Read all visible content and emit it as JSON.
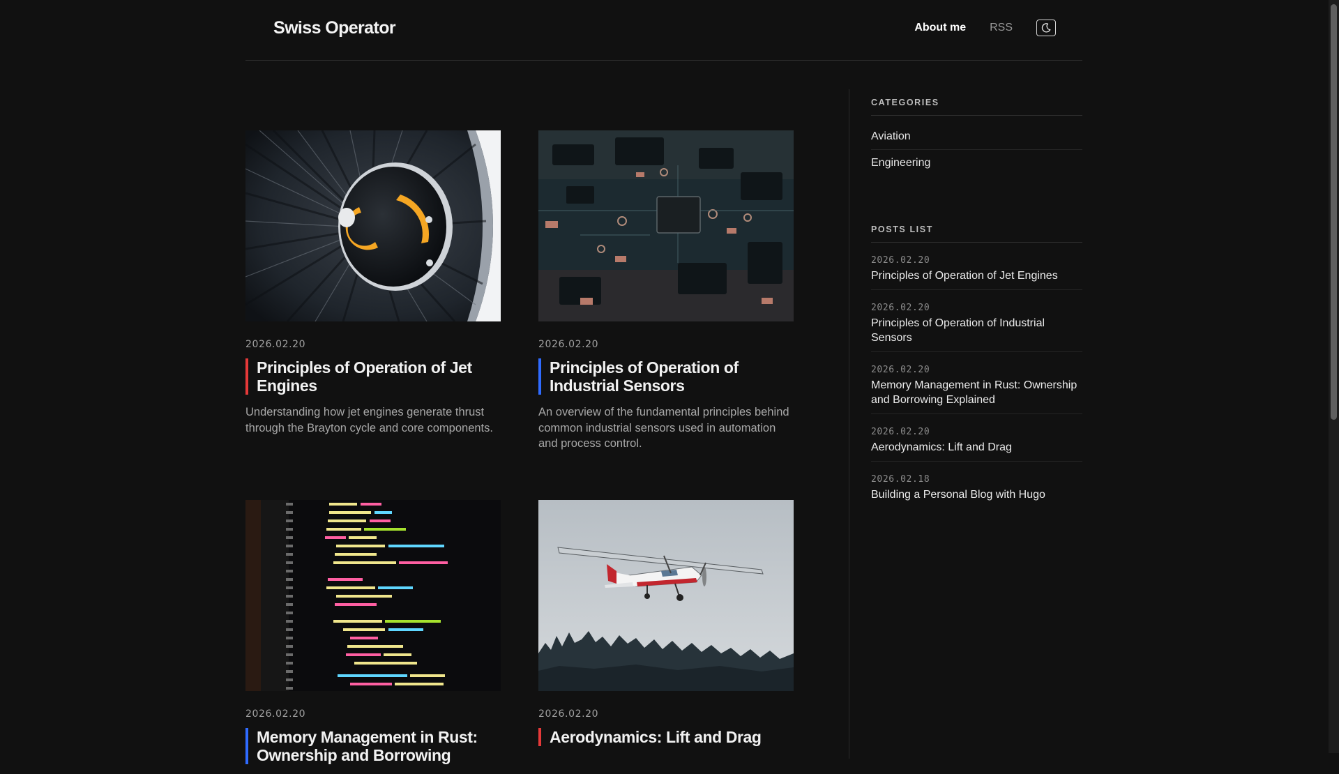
{
  "header": {
    "brand": "Swiss Operator",
    "nav": {
      "about": "About me",
      "rss": "RSS"
    },
    "theme_toggle_icon": "moon-icon"
  },
  "posts": [
    {
      "date": "2026.02.20",
      "title": "Principles of Operation of Jet Engines",
      "excerpt": "Understanding how jet engines generate thrust through the Brayton cycle and core components.",
      "accent": "#e53939",
      "image": "jet-engine-fan-image"
    },
    {
      "date": "2026.02.20",
      "title": "Principles of Operation of Industrial Sensors",
      "excerpt": "An overview of the fundamental principles behind common industrial sensors used in automation and process control.",
      "accent": "#2f6bff",
      "image": "circuit-board-image"
    },
    {
      "date": "2026.02.20",
      "title": "Memory Management in Rust: Ownership and Borrowing",
      "excerpt": "",
      "accent": "#2f6bff",
      "image": "code-screen-image"
    },
    {
      "date": "2026.02.20",
      "title": "Aerodynamics: Lift and Drag",
      "excerpt": "",
      "accent": "#e53939",
      "image": "airplane-image"
    }
  ],
  "sidebar": {
    "categories_heading": "CATEGORIES",
    "categories": [
      "Aviation",
      "Engineering"
    ],
    "posts_heading": "POSTS LIST",
    "posts_list": [
      {
        "date": "2026.02.20",
        "title": "Principles of Operation of Jet Engines"
      },
      {
        "date": "2026.02.20",
        "title": "Principles of Operation of Industrial Sensors"
      },
      {
        "date": "2026.02.20",
        "title": "Memory Management in Rust: Ownership and Borrowing Explained"
      },
      {
        "date": "2026.02.20",
        "title": "Aerodynamics: Lift and Drag"
      },
      {
        "date": "2026.02.18",
        "title": "Building a Personal Blog with Hugo"
      }
    ]
  },
  "colors": {
    "background": "#111111",
    "accent_red": "#e53939",
    "accent_blue": "#2f6bff"
  }
}
